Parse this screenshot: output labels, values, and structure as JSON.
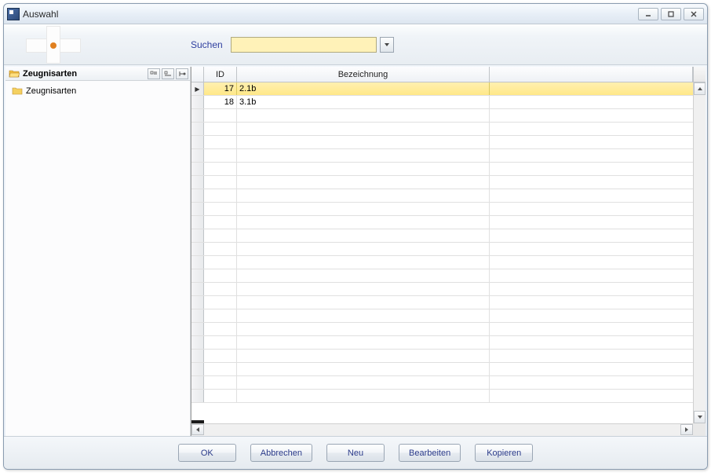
{
  "window": {
    "title": "Auswahl"
  },
  "toolbar": {
    "search_label": "Suchen",
    "search_value": ""
  },
  "sidebar": {
    "header_label": "Zeugnisarten",
    "items": [
      {
        "label": "Zeugnisarten"
      }
    ]
  },
  "grid": {
    "columns": {
      "id": "ID",
      "bezeichnung": "Bezeichnung"
    },
    "rows": [
      {
        "id": "17",
        "bezeichnung": "2.1b",
        "selected": true
      },
      {
        "id": "18",
        "bezeichnung": "3.1b",
        "selected": false
      }
    ]
  },
  "buttons": {
    "ok": "OK",
    "cancel": "Abbrechen",
    "new": "Neu",
    "edit": "Bearbeiten",
    "copy": "Kopieren"
  }
}
